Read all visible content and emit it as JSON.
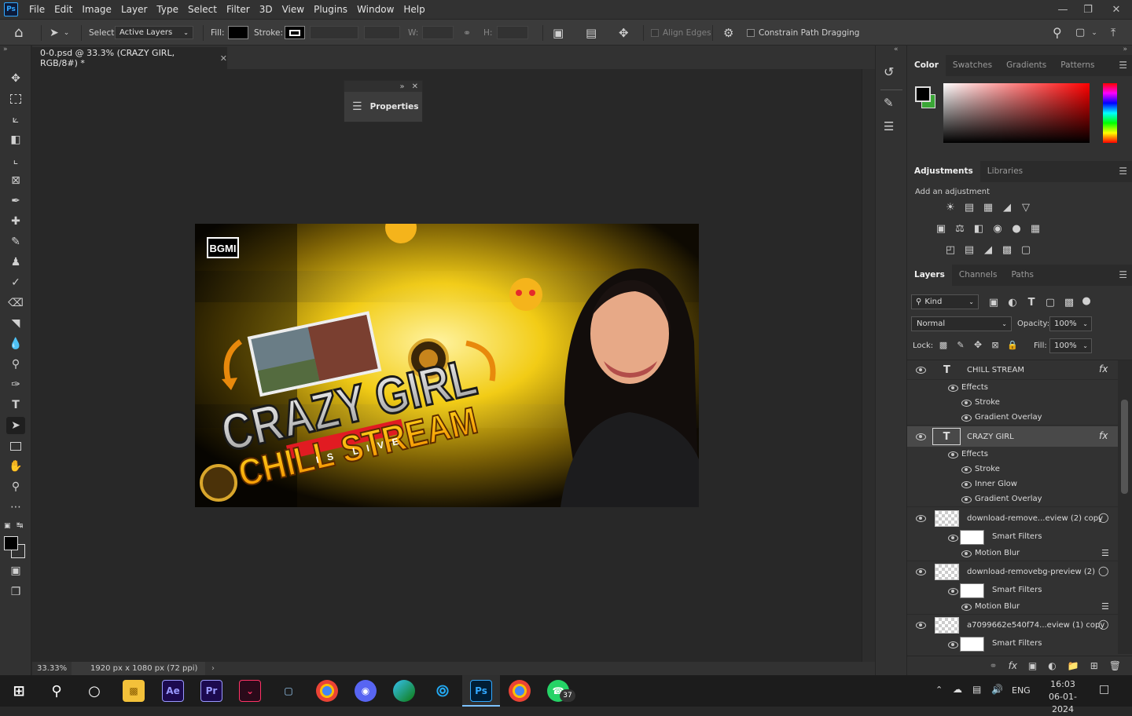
{
  "menubar": {
    "app_badge": "Ps",
    "items": [
      "File",
      "Edit",
      "Image",
      "Layer",
      "Type",
      "Select",
      "Filter",
      "3D",
      "View",
      "Plugins",
      "Window",
      "Help"
    ]
  },
  "options": {
    "select_label": "Select:",
    "select_value": "Active Layers",
    "fill_label": "Fill:",
    "stroke_label": "Stroke:",
    "w_label": "W:",
    "h_label": "H:",
    "align_edges": "Align Edges",
    "constrain": "Constrain Path Dragging"
  },
  "document": {
    "tab_title": "0-0.psd @ 33.3% (CRAZY GIRL, RGB/8#) *",
    "zoom": "33.33%",
    "doc_info": "1920 px x 1080 px (72 ppi)"
  },
  "properties_panel": {
    "title": "Properties"
  },
  "artwork": {
    "logo": "BGMI",
    "headline": "CRAZY GIRL",
    "subline": "CHILL STREAM",
    "ribbon": "IS LIVE"
  },
  "color_panel": {
    "tabs": [
      "Color",
      "Swatches",
      "Gradients",
      "Patterns"
    ],
    "foreground": "#000000",
    "background": "#3aa636"
  },
  "adjustments_panel": {
    "tabs": [
      "Adjustments",
      "Libraries"
    ],
    "hint": "Add an adjustment"
  },
  "layers_panel": {
    "tabs": [
      "Layers",
      "Channels",
      "Paths"
    ],
    "filter_kind": "Kind",
    "blend_mode": "Normal",
    "opacity_label": "Opacity:",
    "opacity": "100%",
    "lock_label": "Lock:",
    "fill_label": "Fill:",
    "fill": "100%",
    "rows": [
      {
        "type": "text",
        "name": "CHILL STREAM",
        "fx": "fx"
      },
      {
        "type": "effects",
        "name": "Effects"
      },
      {
        "type": "effect",
        "name": "Stroke"
      },
      {
        "type": "effect",
        "name": "Gradient Overlay"
      },
      {
        "type": "text",
        "name": "CRAZY GIRL",
        "fx": "fx",
        "selected": true
      },
      {
        "type": "effects",
        "name": "Effects"
      },
      {
        "type": "effect",
        "name": "Stroke"
      },
      {
        "type": "effect",
        "name": "Inner Glow"
      },
      {
        "type": "effect",
        "name": "Gradient Overlay"
      },
      {
        "type": "smart",
        "name": "download-remove...eview (2) copy"
      },
      {
        "type": "filters",
        "name": "Smart Filters"
      },
      {
        "type": "filter",
        "name": "Motion Blur"
      },
      {
        "type": "smart",
        "name": "download-removebg-preview (2)"
      },
      {
        "type": "filters",
        "name": "Smart Filters"
      },
      {
        "type": "filter",
        "name": "Motion Blur"
      },
      {
        "type": "smart",
        "name": "a7099662e540f74...eview (1) copy"
      },
      {
        "type": "filters",
        "name": "Smart Filters"
      }
    ]
  },
  "taskbar": {
    "time": "16:03",
    "date": "06-01-2024",
    "lang": "ENG",
    "badge": "37",
    "apps": [
      "Ae",
      "Pr",
      "Ps"
    ]
  }
}
